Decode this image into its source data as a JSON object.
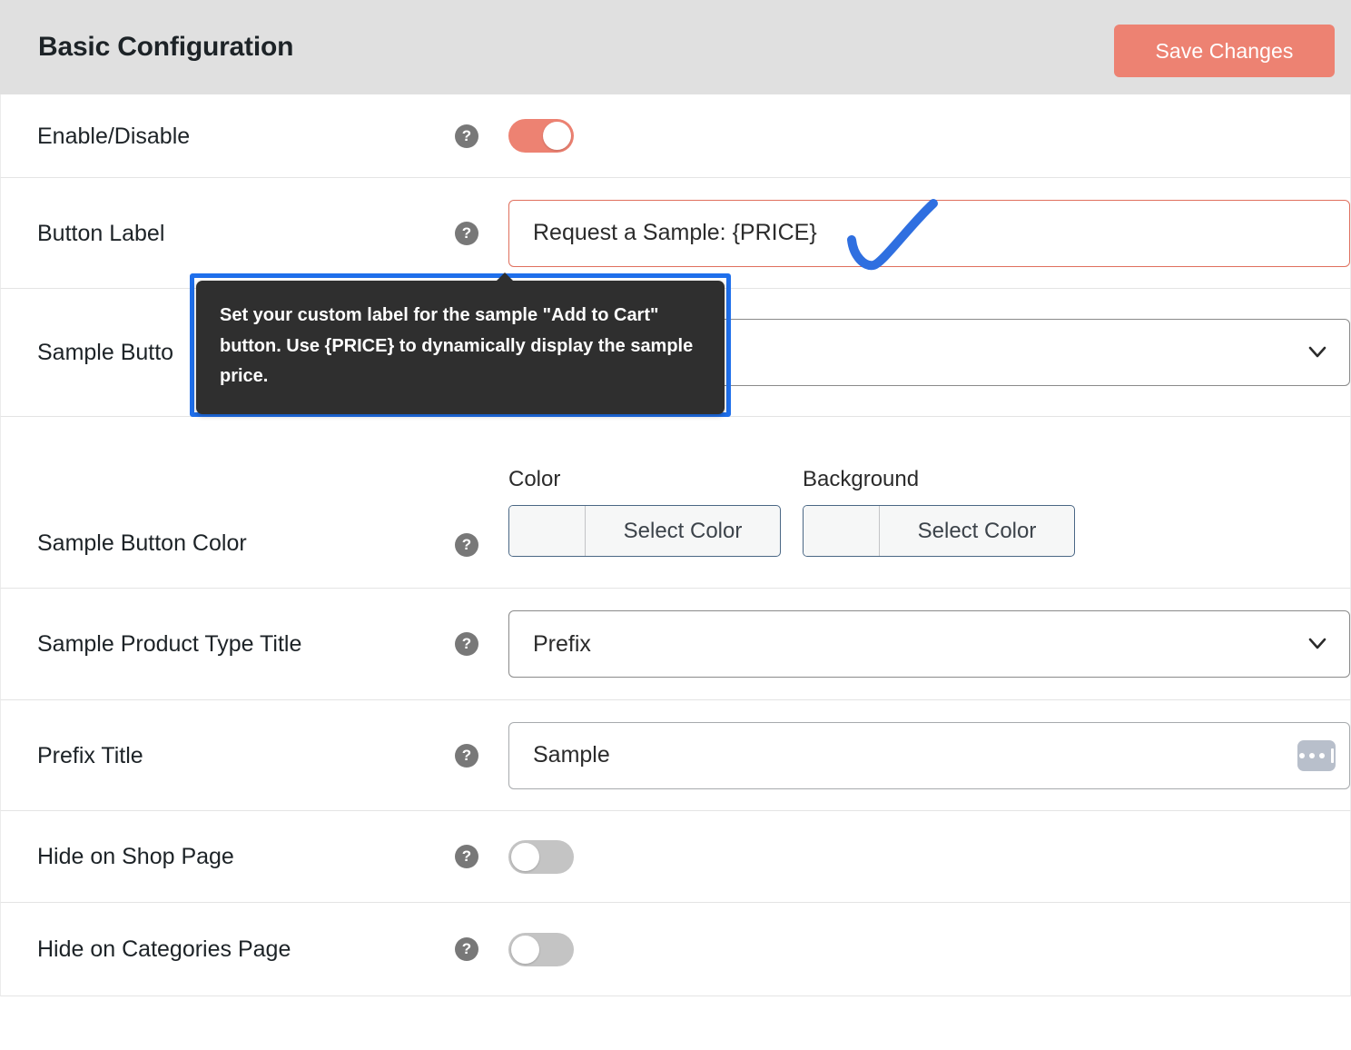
{
  "header": {
    "title": "Basic Configuration",
    "save_label": "Save Changes",
    "accent_color": "#ed8272",
    "background": "#e0e0e0"
  },
  "rows": {
    "enable": {
      "label": "Enable/Disable",
      "help": "?",
      "toggle_state": "on"
    },
    "button_label": {
      "label": "Button Label",
      "help": "?",
      "value": "Request a Sample: {PRICE}",
      "placeholder": "Request a Sample: {PRICE}"
    },
    "sample_button_type": {
      "label": "Sample Butto",
      "full_label": "Sample Button Type",
      "help": "?",
      "value": ""
    },
    "sample_button_color": {
      "label": "Sample Button Color",
      "help": "?",
      "fields": [
        {
          "caption": "Color",
          "button_label": "Select Color",
          "swatch": "#f6f7f7"
        },
        {
          "caption": "Background",
          "button_label": "Select Color",
          "swatch": "#f6f7f7"
        }
      ]
    },
    "product_type_title": {
      "label": "Sample Product Type Title",
      "help": "?",
      "value": "Prefix"
    },
    "prefix_title": {
      "label": "Prefix Title",
      "help": "?",
      "value": "Sample",
      "placeholder": "Sample",
      "suffix_icon": "ellipsis-icon"
    },
    "hide_shop": {
      "label": "Hide on Shop Page",
      "help": "?",
      "toggle_state": "off"
    },
    "hide_categories": {
      "label": "Hide on Categories Page",
      "help": "?",
      "toggle_state": "off"
    }
  },
  "tooltip": {
    "text": "Set your custom label for the sample \"Add to Cart\" button. Use {PRICE} to dynamically display the sample price.",
    "background": "#2f2f2f",
    "highlight_color": "#1f6feb"
  },
  "annotation": {
    "type": "checkmark",
    "color": "#2f6fe0"
  }
}
